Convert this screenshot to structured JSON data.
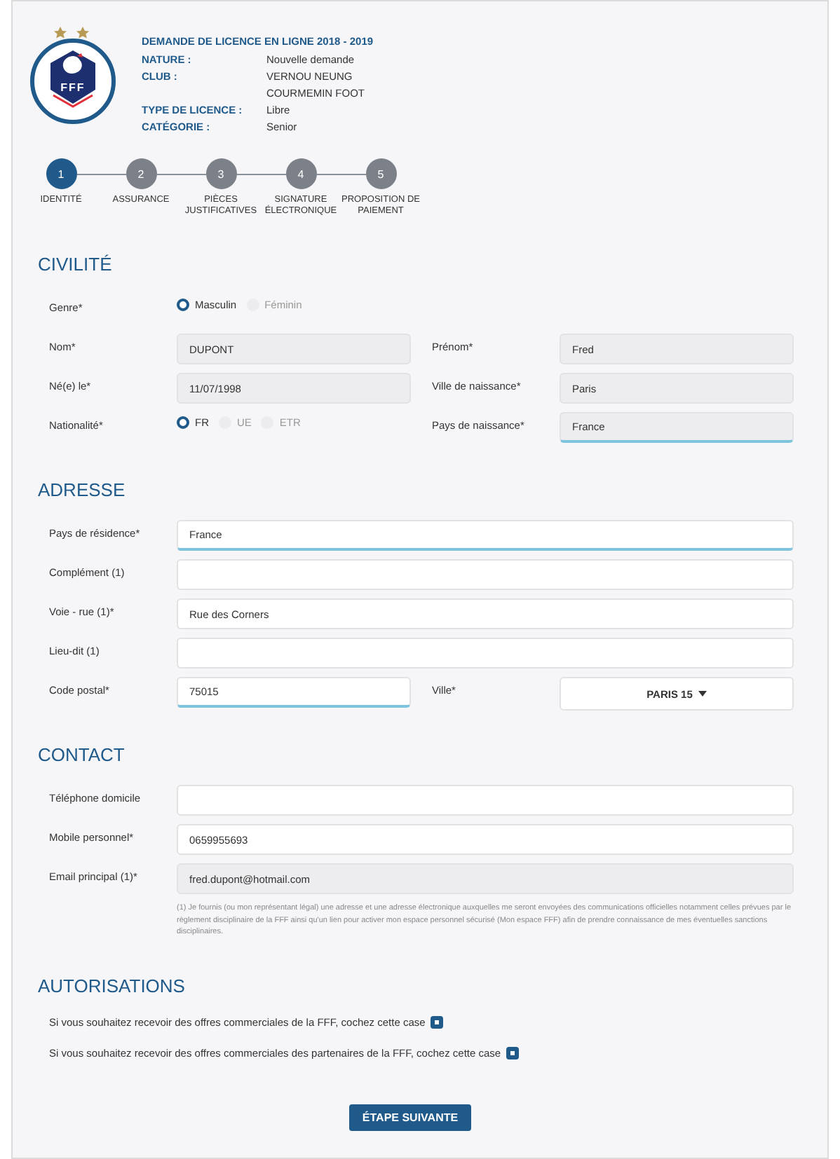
{
  "logo": {
    "text": "FFF"
  },
  "header": {
    "title": "DEMANDE DE LICENCE EN LIGNE 2018 - 2019",
    "details": [
      {
        "label": "NATURE :",
        "value": "Nouvelle demande"
      },
      {
        "label": "CLUB :",
        "value": "VERNOU NEUNG COURMEMIN FOOT"
      },
      {
        "label": "TYPE DE LICENCE :",
        "value": "Libre"
      },
      {
        "label": "CATÉGORIE :",
        "value": "Senior"
      }
    ]
  },
  "steps": [
    {
      "number": "1",
      "label": "IDENTITÉ",
      "selected": true
    },
    {
      "number": "2",
      "label": "ASSURANCE",
      "selected": false
    },
    {
      "number": "3",
      "label": "PIÈCES JUSTIFICATIVES",
      "selected": false
    },
    {
      "number": "4",
      "label": "SIGNATURE ÉLECTRONIQUE",
      "selected": false
    },
    {
      "number": "5",
      "label": "PROPOSITION DE PAIEMENT",
      "selected": false
    }
  ],
  "sections": [
    {
      "title": "CIVILITÉ",
      "rows": [
        [
          {
            "kind": "radio",
            "label": "Genre*",
            "options": [
              {
                "label": "Masculin",
                "selected": true
              },
              {
                "label": "Féminin",
                "selected": false
              }
            ]
          }
        ],
        [
          {
            "kind": "text",
            "label": "Nom*",
            "value": "DUPONT",
            "disabled": true,
            "focused": false
          },
          {
            "kind": "text",
            "label": "Prénom*",
            "value": "Fred",
            "disabled": true,
            "focused": false
          }
        ],
        [
          {
            "kind": "text",
            "label": "Né(e) le*",
            "value": "11/07/1998",
            "disabled": true,
            "focused": false
          },
          {
            "kind": "text",
            "label": "Ville de naissance*",
            "value": "Paris",
            "disabled": true,
            "focused": false
          }
        ],
        [
          {
            "kind": "radio",
            "label": "Nationalité*",
            "options": [
              {
                "label": "FR",
                "selected": true
              },
              {
                "label": "UE",
                "selected": false
              },
              {
                "label": "ETR",
                "selected": false
              }
            ]
          },
          {
            "kind": "text",
            "label": "Pays de naissance*",
            "value": "France",
            "disabled": true,
            "focused": true
          }
        ]
      ]
    },
    {
      "title": "ADRESSE",
      "rows": [
        [
          {
            "kind": "text",
            "label": "Pays de résidence*",
            "value": "France",
            "disabled": false,
            "focused": true
          }
        ],
        [
          {
            "kind": "text",
            "label": "Complément (1)",
            "disabled": false,
            "focused": false
          }
        ],
        [
          {
            "kind": "text",
            "label": "Voie - rue (1)*",
            "value": "Rue des Corners",
            "disabled": false,
            "focused": false
          }
        ],
        [
          {
            "kind": "text",
            "label": "Lieu-dit (1)",
            "disabled": false,
            "focused": false
          }
        ],
        [
          {
            "kind": "text",
            "label": "Code postal*",
            "value": "75015",
            "disabled": false,
            "focused": true
          },
          {
            "kind": "select",
            "label": "Ville*",
            "value": "PARIS 15"
          }
        ]
      ]
    },
    {
      "title": "CONTACT",
      "rows": [
        [
          {
            "kind": "text",
            "label": "Téléphone domicile",
            "disabled": false,
            "focused": false
          }
        ],
        [
          {
            "kind": "text",
            "label": "Mobile personnel*",
            "value": "0659955693",
            "disabled": false,
            "focused": false
          }
        ],
        [
          {
            "kind": "text",
            "label": "Email principal (1)*",
            "value": "fred.dupont@hotmail.com",
            "disabled": true,
            "focused": false
          }
        ]
      ],
      "note": "(1) Je fournis (ou mon représentant légal) une adresse et une adresse électronique auxquelles me seront envoyées des communications officielles notamment celles prévues par le règlement disciplinaire de la FFF ainsi qu'un lien pour activer mon espace personnel sécurisé (Mon espace FFF) afin de prendre connaissance de mes éventuelles sanctions disciplinaires."
    },
    {
      "title": "AUTORISATIONS",
      "checks": [
        {
          "label": "Si vous souhaitez recevoir des offres commerciales de la FFF, cochez cette case",
          "checked": true
        },
        {
          "label": "Si vous souhaitez recevoir des offres commerciales des partenaires de la FFF, cochez cette case",
          "checked": true
        }
      ]
    }
  ],
  "next_button": "ÉTAPE SUIVANTE"
}
